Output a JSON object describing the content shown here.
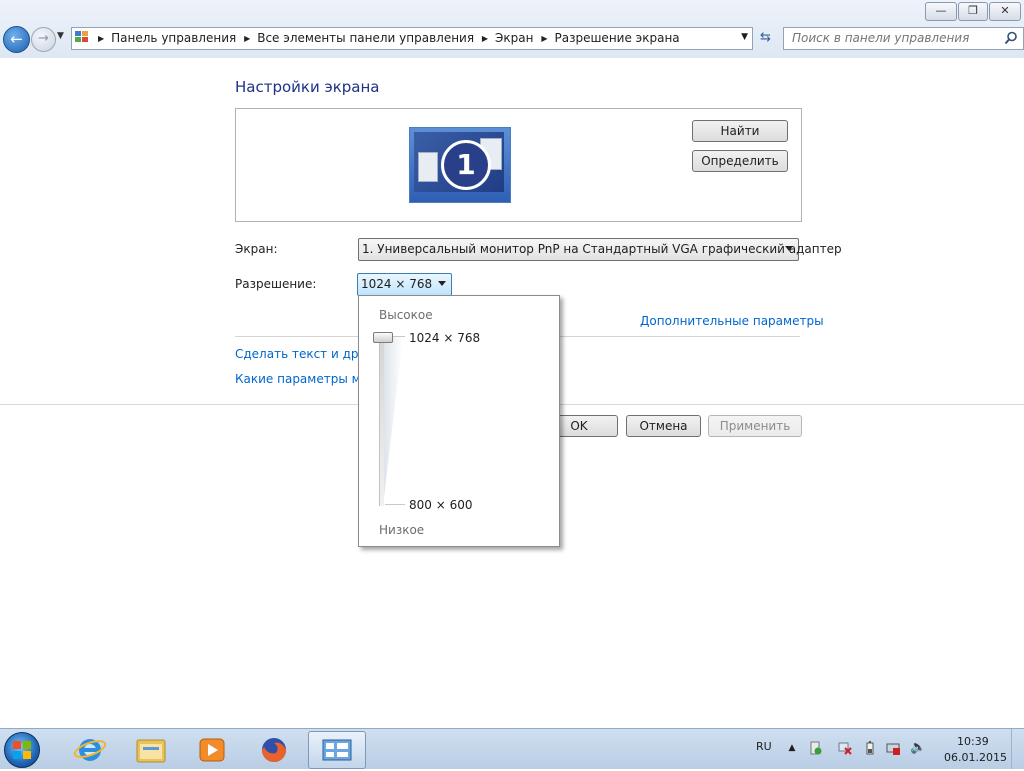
{
  "window": {
    "minimize_label": "—",
    "maximize_label": "❐",
    "close_label": "✕"
  },
  "nav": {
    "back_glyph": "←",
    "forward_glyph": "→",
    "breadcrumbs": [
      "Панель управления",
      "Все элементы панели управления",
      "Экран",
      "Разрешение экрана"
    ],
    "search_placeholder": "Поиск в панели управления"
  },
  "page": {
    "title": "Настройки экрана",
    "detect_button": "Найти",
    "identify_button": "Определить",
    "monitor_number": "1",
    "screen_label": "Экран:",
    "screen_value": "1. Универсальный монитор PnP на Стандартный VGA графический адаптер",
    "resolution_label": "Разрешение:",
    "resolution_value": "1024 × 768",
    "advanced_link": "Дополнительные параметры",
    "link_text_size": "Сделать текст и другие",
    "link_which_settings": "Какие параметры мон",
    "ok_button": "OK",
    "cancel_button": "Отмена",
    "apply_button": "Применить"
  },
  "resolution_popup": {
    "high_label": "Высокое",
    "low_label": "Низкое",
    "options": [
      "1024 × 768",
      "800 × 600"
    ],
    "selected_index": 0
  },
  "taskbar": {
    "language": "RU",
    "time": "10:39",
    "date": "06.01.2015",
    "apps": [
      "start-button",
      "internet-explorer",
      "file-explorer",
      "media-player",
      "firefox",
      "control-panel"
    ],
    "active_app": "control-panel"
  },
  "colors": {
    "link": "#0066cc",
    "title": "#1e3287",
    "monitor_blue": "#2f5fb3"
  }
}
